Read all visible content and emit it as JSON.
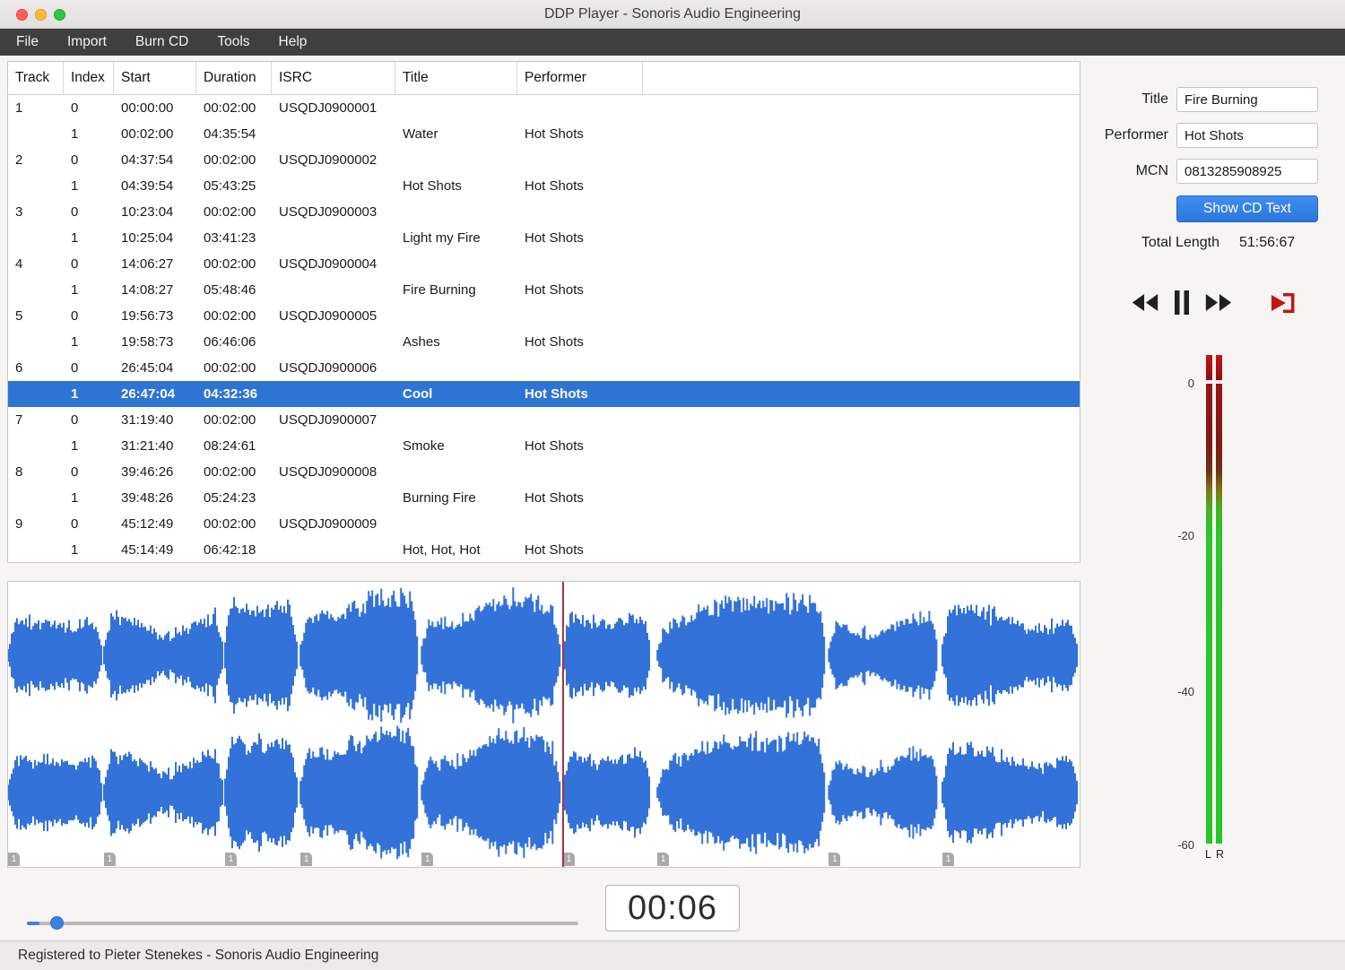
{
  "window": {
    "title": "DDP Player - Sonoris Audio Engineering"
  },
  "menu": {
    "items": [
      "File",
      "Import",
      "Burn CD",
      "Tools",
      "Help"
    ]
  },
  "table": {
    "columns": [
      "Track",
      "Index",
      "Start",
      "Duration",
      "ISRC",
      "Title",
      "Performer"
    ],
    "rows": [
      {
        "track": "1",
        "index": "0",
        "start": "00:00:00",
        "duration": "00:02:00",
        "isrc": "USQDJ0900001",
        "title": "",
        "performer": "",
        "selected": false
      },
      {
        "track": "",
        "index": "1",
        "start": "00:02:00",
        "duration": "04:35:54",
        "isrc": "",
        "title": "Water",
        "performer": "Hot Shots",
        "selected": false
      },
      {
        "track": "2",
        "index": "0",
        "start": "04:37:54",
        "duration": "00:02:00",
        "isrc": "USQDJ0900002",
        "title": "",
        "performer": "",
        "selected": false
      },
      {
        "track": "",
        "index": "1",
        "start": "04:39:54",
        "duration": "05:43:25",
        "isrc": "",
        "title": "Hot Shots",
        "performer": "Hot Shots",
        "selected": false
      },
      {
        "track": "3",
        "index": "0",
        "start": "10:23:04",
        "duration": "00:02:00",
        "isrc": "USQDJ0900003",
        "title": "",
        "performer": "",
        "selected": false
      },
      {
        "track": "",
        "index": "1",
        "start": "10:25:04",
        "duration": "03:41:23",
        "isrc": "",
        "title": "Light my Fire",
        "performer": "Hot Shots",
        "selected": false
      },
      {
        "track": "4",
        "index": "0",
        "start": "14:06:27",
        "duration": "00:02:00",
        "isrc": "USQDJ0900004",
        "title": "",
        "performer": "",
        "selected": false
      },
      {
        "track": "",
        "index": "1",
        "start": "14:08:27",
        "duration": "05:48:46",
        "isrc": "",
        "title": "Fire Burning",
        "performer": "Hot Shots",
        "selected": false
      },
      {
        "track": "5",
        "index": "0",
        "start": "19:56:73",
        "duration": "00:02:00",
        "isrc": "USQDJ0900005",
        "title": "",
        "performer": "",
        "selected": false
      },
      {
        "track": "",
        "index": "1",
        "start": "19:58:73",
        "duration": "06:46:06",
        "isrc": "",
        "title": "Ashes",
        "performer": "Hot Shots",
        "selected": false
      },
      {
        "track": "6",
        "index": "0",
        "start": "26:45:04",
        "duration": "00:02:00",
        "isrc": "USQDJ0900006",
        "title": "",
        "performer": "",
        "selected": false
      },
      {
        "track": "",
        "index": "1",
        "start": "26:47:04",
        "duration": "04:32:36",
        "isrc": "",
        "title": "Cool",
        "performer": "Hot Shots",
        "selected": true
      },
      {
        "track": "7",
        "index": "0",
        "start": "31:19:40",
        "duration": "00:02:00",
        "isrc": "USQDJ0900007",
        "title": "",
        "performer": "",
        "selected": false
      },
      {
        "track": "",
        "index": "1",
        "start": "31:21:40",
        "duration": "08:24:61",
        "isrc": "",
        "title": "Smoke",
        "performer": "Hot Shots",
        "selected": false
      },
      {
        "track": "8",
        "index": "0",
        "start": "39:46:26",
        "duration": "00:02:00",
        "isrc": "USQDJ0900008",
        "title": "",
        "performer": "",
        "selected": false
      },
      {
        "track": "",
        "index": "1",
        "start": "39:48:26",
        "duration": "05:24:23",
        "isrc": "",
        "title": "Burning Fire",
        "performer": "Hot Shots",
        "selected": false
      },
      {
        "track": "9",
        "index": "0",
        "start": "45:12:49",
        "duration": "00:02:00",
        "isrc": "USQDJ0900009",
        "title": "",
        "performer": "",
        "selected": false
      },
      {
        "track": "",
        "index": "1",
        "start": "45:14:49",
        "duration": "06:42:18",
        "isrc": "",
        "title": "Hot, Hot, Hot",
        "performer": "Hot Shots",
        "selected": false
      }
    ]
  },
  "details": {
    "title_label": "Title",
    "title_value": "Fire Burning",
    "performer_label": "Performer",
    "performer_value": "Hot Shots",
    "mcn_label": "MCN",
    "mcn_value": "0813285908925",
    "show_cd_text_label": "Show CD Text",
    "total_length_label": "Total Length",
    "total_length_value": "51:56:67"
  },
  "transport": {
    "time_display": "00:06"
  },
  "meters": {
    "scale": [
      "0",
      "-20",
      "-40",
      "-60"
    ],
    "left_label": "L",
    "right_label": "R"
  },
  "waveform": {
    "marker_label": "1",
    "playhead_pct": 51.7,
    "segments": [
      {
        "start": 0.0,
        "width": 8.8
      },
      {
        "start": 8.95,
        "width": 11.1
      },
      {
        "start": 20.25,
        "width": 6.75
      },
      {
        "start": 27.3,
        "width": 11.0
      },
      {
        "start": 38.6,
        "width": 12.9
      },
      {
        "start": 51.8,
        "width": 8.2
      },
      {
        "start": 60.6,
        "width": 15.7
      },
      {
        "start": 76.6,
        "width": 10.2
      },
      {
        "start": 87.2,
        "width": 12.6
      }
    ]
  },
  "status": {
    "text": "Registered to Pieter Stenekes - Sonoris Audio Engineering"
  },
  "colors": {
    "selection": "#2e74d4",
    "waveform": "#3373d9",
    "accent": "#2f80e4",
    "playhead": "#b03040"
  }
}
